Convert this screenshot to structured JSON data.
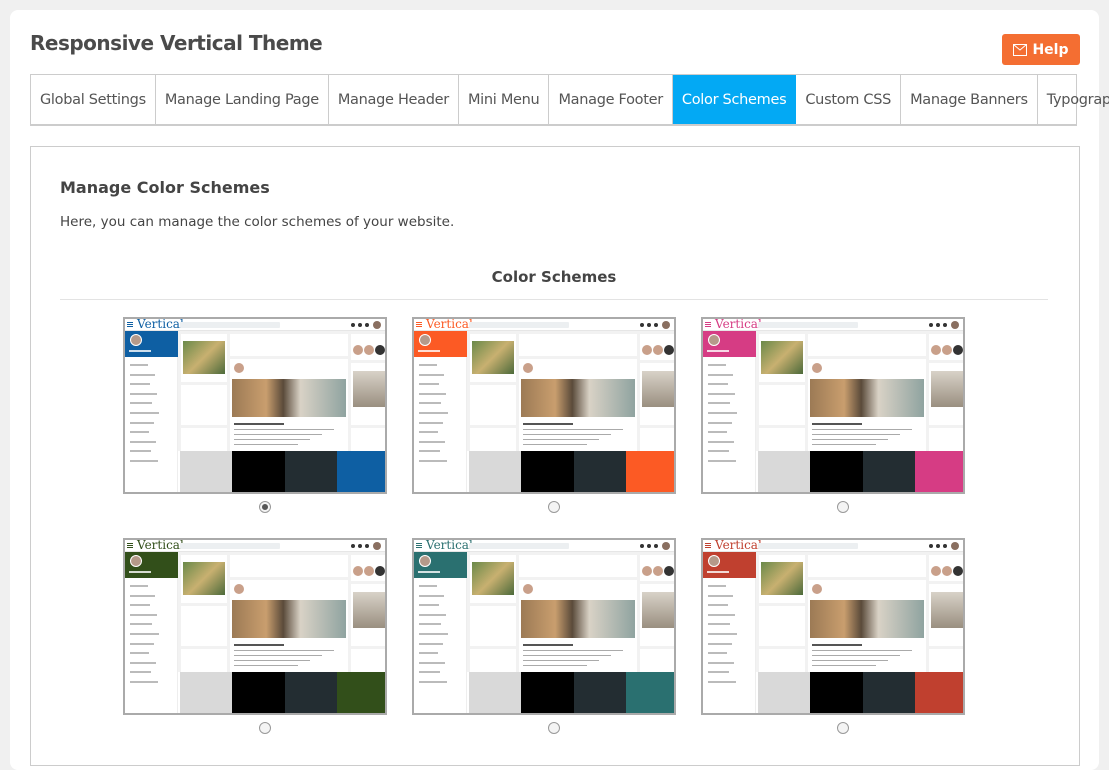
{
  "page_title": "Responsive Vertical Theme",
  "help_button": {
    "label": "Help",
    "icon": "envelope-icon",
    "color": "#f46e32"
  },
  "tabs": [
    {
      "label": "Global Settings",
      "active": false
    },
    {
      "label": "Manage Landing Page",
      "active": false
    },
    {
      "label": "Manage Header",
      "active": false
    },
    {
      "label": "Mini Menu",
      "active": false
    },
    {
      "label": "Manage Footer",
      "active": false
    },
    {
      "label": "Color Schemes",
      "active": true
    },
    {
      "label": "Custom CSS",
      "active": false
    },
    {
      "label": "Manage Banners",
      "active": false
    },
    {
      "label": "Typography",
      "active": false
    }
  ],
  "active_tab_color": "#03a9f4",
  "panel": {
    "heading": "Manage Color Schemes",
    "description": "Here, you can manage the color schemes of your website.",
    "section_title": "Color Schemes"
  },
  "schemes": [
    {
      "accent": "#0e5fa3",
      "swatches": [
        "#d9d9d9",
        "#000000",
        "#232d32",
        "#0e5fa3"
      ],
      "selected": true,
      "logo": "Vertical"
    },
    {
      "accent": "#fc5a24",
      "swatches": [
        "#d9d9d9",
        "#000000",
        "#232d32",
        "#fc5a24"
      ],
      "selected": false,
      "logo": "Vertical"
    },
    {
      "accent": "#d63c84",
      "swatches": [
        "#d9d9d9",
        "#000000",
        "#232d32",
        "#d63c84"
      ],
      "selected": false,
      "logo": "Vertical"
    },
    {
      "accent": "#324f1a",
      "swatches": [
        "#d9d9d9",
        "#000000",
        "#232d32",
        "#324f1a"
      ],
      "selected": false,
      "logo": "Vertical"
    },
    {
      "accent": "#2a7070",
      "swatches": [
        "#d9d9d9",
        "#000000",
        "#232d32",
        "#2a7070"
      ],
      "selected": false,
      "logo": "Vertical"
    },
    {
      "accent": "#c0402f",
      "swatches": [
        "#d9d9d9",
        "#000000",
        "#232d32",
        "#c0402f"
      ],
      "selected": false,
      "logo": "Vertical"
    }
  ]
}
